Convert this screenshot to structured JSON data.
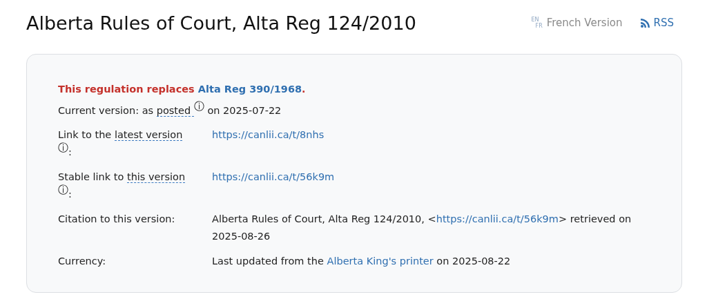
{
  "title": "Alberta Rules of Court, Alta Reg 124/2010",
  "header_links": [
    {
      "kind": "language",
      "badge_top": "EN",
      "badge_bottom": "FR",
      "label": "French Version"
    },
    {
      "kind": "rss",
      "label": "RSS"
    }
  ],
  "notice": {
    "text": "This regulation replaces ",
    "link": "Alta Reg 390/1968",
    "after": "."
  },
  "current_version": [
    {
      "kind": "text",
      "text": "Current version: as "
    },
    {
      "kind": "term",
      "text": "posted "
    },
    {
      "kind": "info",
      "text": "ⓘ"
    },
    {
      "kind": "text",
      "text": " on 2025-07-22"
    }
  ],
  "rows": [
    {
      "label": [
        {
          "kind": "text",
          "text": "Link to the "
        },
        {
          "kind": "term",
          "text": "latest version "
        },
        {
          "kind": "info",
          "text": "ⓘ"
        },
        {
          "kind": "text",
          "text": ":"
        }
      ],
      "value": [
        {
          "kind": "link",
          "text": "https://canlii.ca/t/8nhs"
        }
      ]
    },
    {
      "label": [
        {
          "kind": "text",
          "text": "Stable link to "
        },
        {
          "kind": "term",
          "text": "this version "
        },
        {
          "kind": "info",
          "text": "ⓘ"
        },
        {
          "kind": "text",
          "text": ":"
        }
      ],
      "value": [
        {
          "kind": "link",
          "text": "https://canlii.ca/t/56k9m"
        }
      ]
    },
    {
      "label": [
        {
          "kind": "text",
          "text": "Citation to this version:"
        }
      ],
      "value": [
        {
          "kind": "text",
          "text": "Alberta Rules of Court, Alta Reg 124/2010, <"
        },
        {
          "kind": "link",
          "text": "https://canlii.ca/t/56k9m"
        },
        {
          "kind": "text",
          "text": "> retrieved on 2025-08-26"
        }
      ]
    },
    {
      "label": [
        {
          "kind": "text",
          "text": "Currency:"
        }
      ],
      "value": [
        {
          "kind": "text",
          "text": "Last updated from the "
        },
        {
          "kind": "link",
          "text": "Alberta King's printer"
        },
        {
          "kind": "text",
          "text": " on 2025-08-22"
        }
      ]
    }
  ]
}
